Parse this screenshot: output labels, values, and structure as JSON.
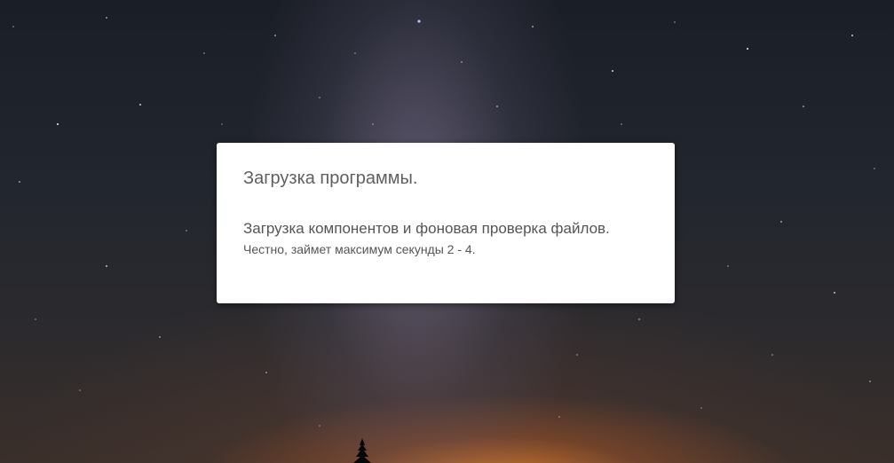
{
  "dialog": {
    "title": "Загрузка программы.",
    "message": "Загрузка компонентов и фоновая проверка файлов.",
    "note": "Честно, займет максимум секунды 2 - 4."
  },
  "background": {
    "description_icon": "night-sky-milky-way",
    "colors": {
      "sky": "#1f232b",
      "glow": "#d8782a",
      "dialog": "#ffffff",
      "text": "#5f5f5f"
    }
  }
}
